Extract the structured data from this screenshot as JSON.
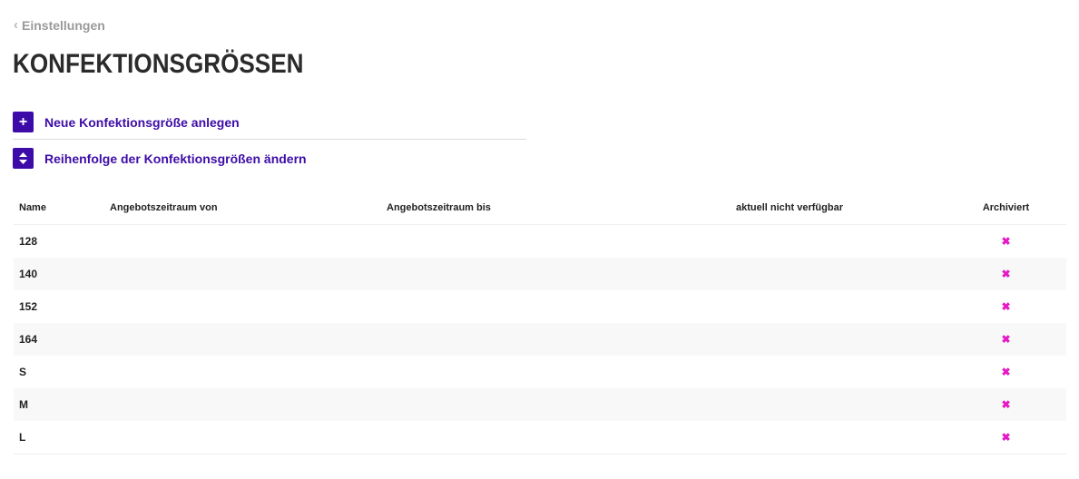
{
  "breadcrumb": {
    "back_label": "Einstellungen"
  },
  "page": {
    "title": "KONFEKTIONSGRÖSSEN"
  },
  "actions": {
    "create_label": "Neue Konfektionsgröße anlegen",
    "reorder_label": "Reihenfolge der Konfektionsgrößen ändern"
  },
  "table": {
    "headers": {
      "name": "Name",
      "from": "Angebotszeitraum von",
      "to": "Angebotszeitraum bis",
      "unavailable": "aktuell nicht verfügbar",
      "archived": "Archiviert"
    },
    "rows": [
      {
        "name": "128",
        "from": "",
        "to": "",
        "unavailable": "",
        "archived": "✖"
      },
      {
        "name": "140",
        "from": "",
        "to": "",
        "unavailable": "",
        "archived": "✖"
      },
      {
        "name": "152",
        "from": "",
        "to": "",
        "unavailable": "",
        "archived": "✖"
      },
      {
        "name": "164",
        "from": "",
        "to": "",
        "unavailable": "",
        "archived": "✖"
      },
      {
        "name": "S",
        "from": "",
        "to": "",
        "unavailable": "",
        "archived": "✖"
      },
      {
        "name": "M",
        "from": "",
        "to": "",
        "unavailable": "",
        "archived": "✖"
      },
      {
        "name": "L",
        "from": "",
        "to": "",
        "unavailable": "",
        "archived": "✖"
      }
    ]
  },
  "colors": {
    "accent": "#3d0ca8",
    "archived_mark": "#e619c4"
  }
}
